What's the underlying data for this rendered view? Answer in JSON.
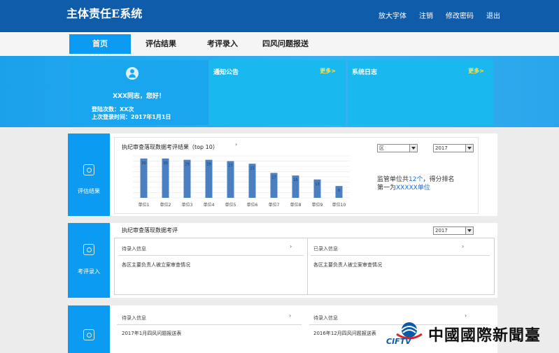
{
  "app": {
    "title": "主体责任E系统"
  },
  "top_links": [
    "放大字体",
    "注销",
    "修改密码",
    "退出"
  ],
  "tabs": [
    "首页",
    "评估结果",
    "考评录入",
    "四风问题报送"
  ],
  "user_card": {
    "greeting": "XXX同志，您好！",
    "login_count": "登陆次数：XX次",
    "last_login": "上次登录时间：2017年1月1日"
  },
  "notice_card": {
    "title": "通知公告",
    "more": "更多>"
  },
  "log_card": {
    "title": "系统日志",
    "more": "更多>"
  },
  "eval_panel": {
    "label": "评估结果",
    "chart_title": "执纪审查落现数据考评结果（top 10）",
    "chev": "›",
    "region_select": "区",
    "year_select": "2017",
    "rank_line1_pre": "监管单位共",
    "rank_count": "12个",
    "rank_line1_post": "，得分排名",
    "rank_line2_pre": "第一为",
    "rank_unit": "XXXXX单位"
  },
  "chart_data": {
    "type": "bar",
    "categories": [
      "单位1",
      "单位2",
      "单位3",
      "单位4",
      "单位5",
      "单位6",
      "单位7",
      "单位8",
      "单位9",
      "单位10"
    ],
    "values": [
      30,
      30,
      29,
      29,
      28,
      26,
      19,
      17,
      14,
      9
    ],
    "data_labels": [
      "30",
      "30",
      "29",
      "29",
      "27",
      "25",
      "17",
      "15",
      "13",
      "8"
    ],
    "ylim": [
      0,
      32
    ],
    "grid": true,
    "color": "#4a7fc1"
  },
  "entry_panel": {
    "label": "考评录入",
    "title": "执纪审查落现数据考评",
    "year_select": "2017",
    "left_head": "待录入信息",
    "right_head": "已录入信息",
    "chev": "›",
    "left_item": "各区主要负责人被立案审查情况",
    "right_item": "各区主要负责人被立案审查情况"
  },
  "report_panel": {
    "left_head": "待录入信息",
    "right_head": "待录入信息",
    "chev": "›",
    "left_item": "2017年1月四风问题报送表",
    "right_item": "2016年12月四风问题报送表"
  },
  "watermark": {
    "en": "CIFTV",
    "cn": "中國國際新聞臺"
  }
}
